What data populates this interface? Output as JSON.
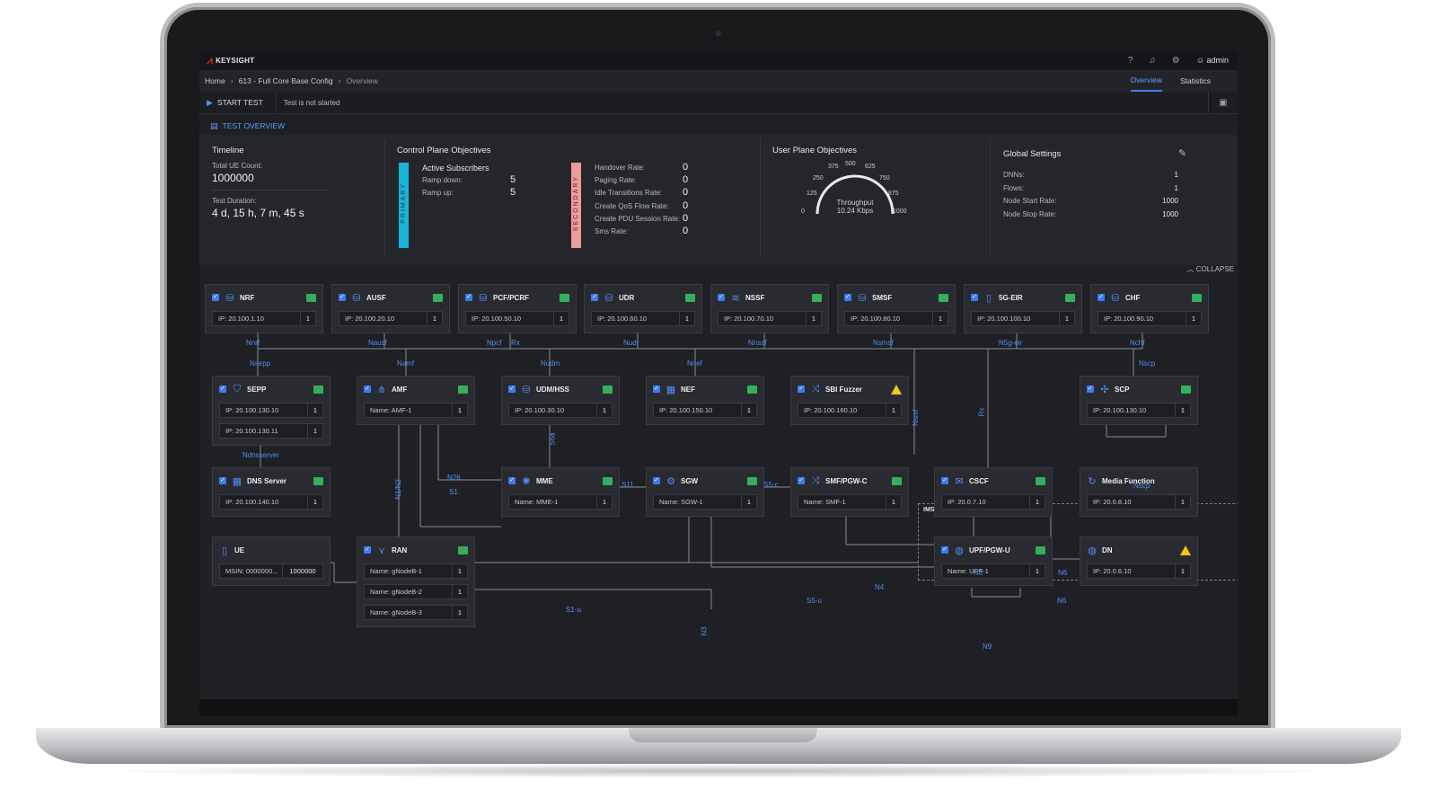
{
  "app": {
    "brand": "KEYSIGHT",
    "user": "admin"
  },
  "breadcrumb": [
    "Home",
    "613 - Full Core Base Config",
    "Overview"
  ],
  "view_tabs": [
    "Overview",
    "Statistics"
  ],
  "actions": {
    "start": "START TEST",
    "status": "Test is not started"
  },
  "section_tab": "TEST OVERVIEW",
  "timeline": {
    "title": "Timeline",
    "ue_label": "Total UE Count:",
    "ue_value": "1000000",
    "dur_label": "Test Duration:",
    "dur_value": "4 d, 15 h, 7 m, 45 s"
  },
  "control": {
    "title": "Control Plane Objectives",
    "primary": "PRIMARY",
    "secondary": "SECONDARY",
    "active_subscribers": "Active Subscribers",
    "primary_rows": [
      {
        "label": "Ramp down:",
        "value": "5"
      },
      {
        "label": "Ramp up:",
        "value": "5"
      }
    ],
    "secondary_rows": [
      {
        "label": "Handover Rate:",
        "value": "0"
      },
      {
        "label": "Paging Rate:",
        "value": "0"
      },
      {
        "label": "Idle Transitions Rate:",
        "value": "0"
      },
      {
        "label": "Create QoS Flow Rate:",
        "value": "0"
      },
      {
        "label": "Create PDU Session Rate:",
        "value": "0"
      },
      {
        "label": "Sms Rate:",
        "value": "0"
      }
    ]
  },
  "user_plane": {
    "title": "User Plane Objectives",
    "gauge_ticks": [
      "0",
      "125",
      "250",
      "375",
      "500",
      "625",
      "750",
      "875",
      "1000"
    ],
    "gauge_title": "Throughput",
    "gauge_value": "10.24 Kbps"
  },
  "global": {
    "title": "Global Settings",
    "rows": [
      {
        "label": "DNNs:",
        "value": "1"
      },
      {
        "label": "Flows:",
        "value": "1"
      },
      {
        "label": "Node Start Rate:",
        "value": "1000"
      },
      {
        "label": "Node Stop Rate:",
        "value": "1000"
      }
    ]
  },
  "collapse": "COLLAPSE",
  "ims_label": "IMS",
  "nodes": [
    {
      "name": "NRF",
      "icon": "database-icon",
      "status": "ok",
      "fields": [
        {
          "text": "IP: 20.100.1.10",
          "count": "1"
        }
      ]
    },
    {
      "name": "AUSF",
      "icon": "database-icon",
      "status": "ok",
      "fields": [
        {
          "text": "IP: 20.100.20.10",
          "count": "1"
        }
      ]
    },
    {
      "name": "PCF/PCRF",
      "icon": "database-icon",
      "status": "ok",
      "fields": [
        {
          "text": "IP: 20.100.50.10",
          "count": "1"
        }
      ]
    },
    {
      "name": "UDR",
      "icon": "database-icon",
      "status": "ok",
      "fields": [
        {
          "text": "IP: 20.100.60.10",
          "count": "1"
        }
      ]
    },
    {
      "name": "NSSF",
      "icon": "layers-icon",
      "status": "ok",
      "fields": [
        {
          "text": "IP: 20.100.70.10",
          "count": "1"
        }
      ]
    },
    {
      "name": "SMSF",
      "icon": "database-icon",
      "status": "ok",
      "fields": [
        {
          "text": "IP: 20.100.80.10",
          "count": "1"
        }
      ]
    },
    {
      "name": "5G-EIR",
      "icon": "phone-icon",
      "status": "ok",
      "fields": [
        {
          "text": "IP: 20.100.100.10",
          "count": "1"
        }
      ]
    },
    {
      "name": "CHF",
      "icon": "database-icon",
      "status": "ok",
      "fields": [
        {
          "text": "IP: 20.100.90.10",
          "count": "1"
        }
      ]
    },
    {
      "name": "SEPP",
      "icon": "shield-icon",
      "status": "ok",
      "fields": [
        {
          "text": "IP: 20.100.130.10",
          "count": "1"
        },
        {
          "text": "IP: 20.100.130.11",
          "count": "1"
        }
      ]
    },
    {
      "name": "AMF",
      "icon": "hierarchy-icon",
      "status": "ok",
      "fields": [
        {
          "text": "Name: AMF-1",
          "count": "1"
        }
      ]
    },
    {
      "name": "UDM/HSS",
      "icon": "database-icon",
      "status": "ok",
      "fields": [
        {
          "text": "IP: 20.100.30.10",
          "count": "1"
        }
      ]
    },
    {
      "name": "NEF",
      "icon": "server-icon",
      "status": "ok",
      "fields": [
        {
          "text": "IP: 20.100.150.10",
          "count": "1"
        }
      ]
    },
    {
      "name": "SBI Fuzzer",
      "icon": "shuffle-icon",
      "status": "warn",
      "fields": [
        {
          "text": "IP: 20.100.160.10",
          "count": "1"
        }
      ]
    },
    {
      "name": "SCP",
      "icon": "network-icon",
      "status": "ok",
      "fields": [
        {
          "text": "IP: 20.100.130.10",
          "count": "1"
        }
      ]
    },
    {
      "name": "DNS Server",
      "icon": "server-icon",
      "status": "ok",
      "fields": [
        {
          "text": "IP: 20.100.140.10",
          "count": "1"
        }
      ]
    },
    {
      "name": "MME",
      "icon": "hub-icon",
      "status": "ok",
      "fields": [
        {
          "text": "Name: MME-1",
          "count": "1"
        }
      ]
    },
    {
      "name": "SGW",
      "icon": "gear-icon",
      "status": "ok",
      "fields": [
        {
          "text": "Name: SGW-1",
          "count": "1"
        }
      ]
    },
    {
      "name": "SMF/PGW-C",
      "icon": "shuffle-icon",
      "status": "ok",
      "fields": [
        {
          "text": "Name: SMF-1",
          "count": "1"
        }
      ]
    },
    {
      "name": "CSCF",
      "icon": "chat-icon",
      "status": "ok",
      "fields": [
        {
          "text": "IP: 20.0.7.10",
          "count": "1"
        }
      ]
    },
    {
      "name": "Media Function",
      "icon": "sync-icon",
      "status": "none",
      "fields": [
        {
          "text": "IP: 20.0.8.10",
          "count": "1"
        }
      ]
    },
    {
      "name": "UE",
      "icon": "phone-icon",
      "status": "none",
      "fields": [
        {
          "text": "MSIN: 0000000...",
          "count": "1000000"
        }
      ]
    },
    {
      "name": "RAN",
      "icon": "antenna-icon",
      "status": "ok",
      "fields": [
        {
          "text": "Name: gNodeB-1",
          "count": "1"
        },
        {
          "text": "Name: gNodeB-2",
          "count": "1"
        },
        {
          "text": "Name: gNodeB-3",
          "count": "1"
        }
      ]
    },
    {
      "name": "UPF/PGW-U",
      "icon": "globe-icon",
      "status": "ok",
      "fields": [
        {
          "text": "Name: UPF-1",
          "count": "1"
        }
      ]
    },
    {
      "name": "DN",
      "icon": "globe-icon",
      "status": "warn",
      "fields": [
        {
          "text": "IP: 20.0.6.10",
          "count": "1"
        }
      ]
    }
  ],
  "interfaces": [
    "Nnrf",
    "Nausf",
    "Npcf",
    "Rx",
    "Nudr",
    "Nnssf",
    "Nsmsf",
    "N5g-eir",
    "Nchf",
    "Nsepp",
    "Namf",
    "Nudm",
    "Nnef",
    "Nscp",
    "Ndnsserver",
    "N1/N2",
    "N26",
    "S1",
    "S6a",
    "S11",
    "S5-c",
    "Nsmf",
    "Rx",
    "Nscp",
    "N6",
    "N6",
    "N4",
    "S1-u",
    "S5-u",
    "N3",
    "N6",
    "N9"
  ]
}
